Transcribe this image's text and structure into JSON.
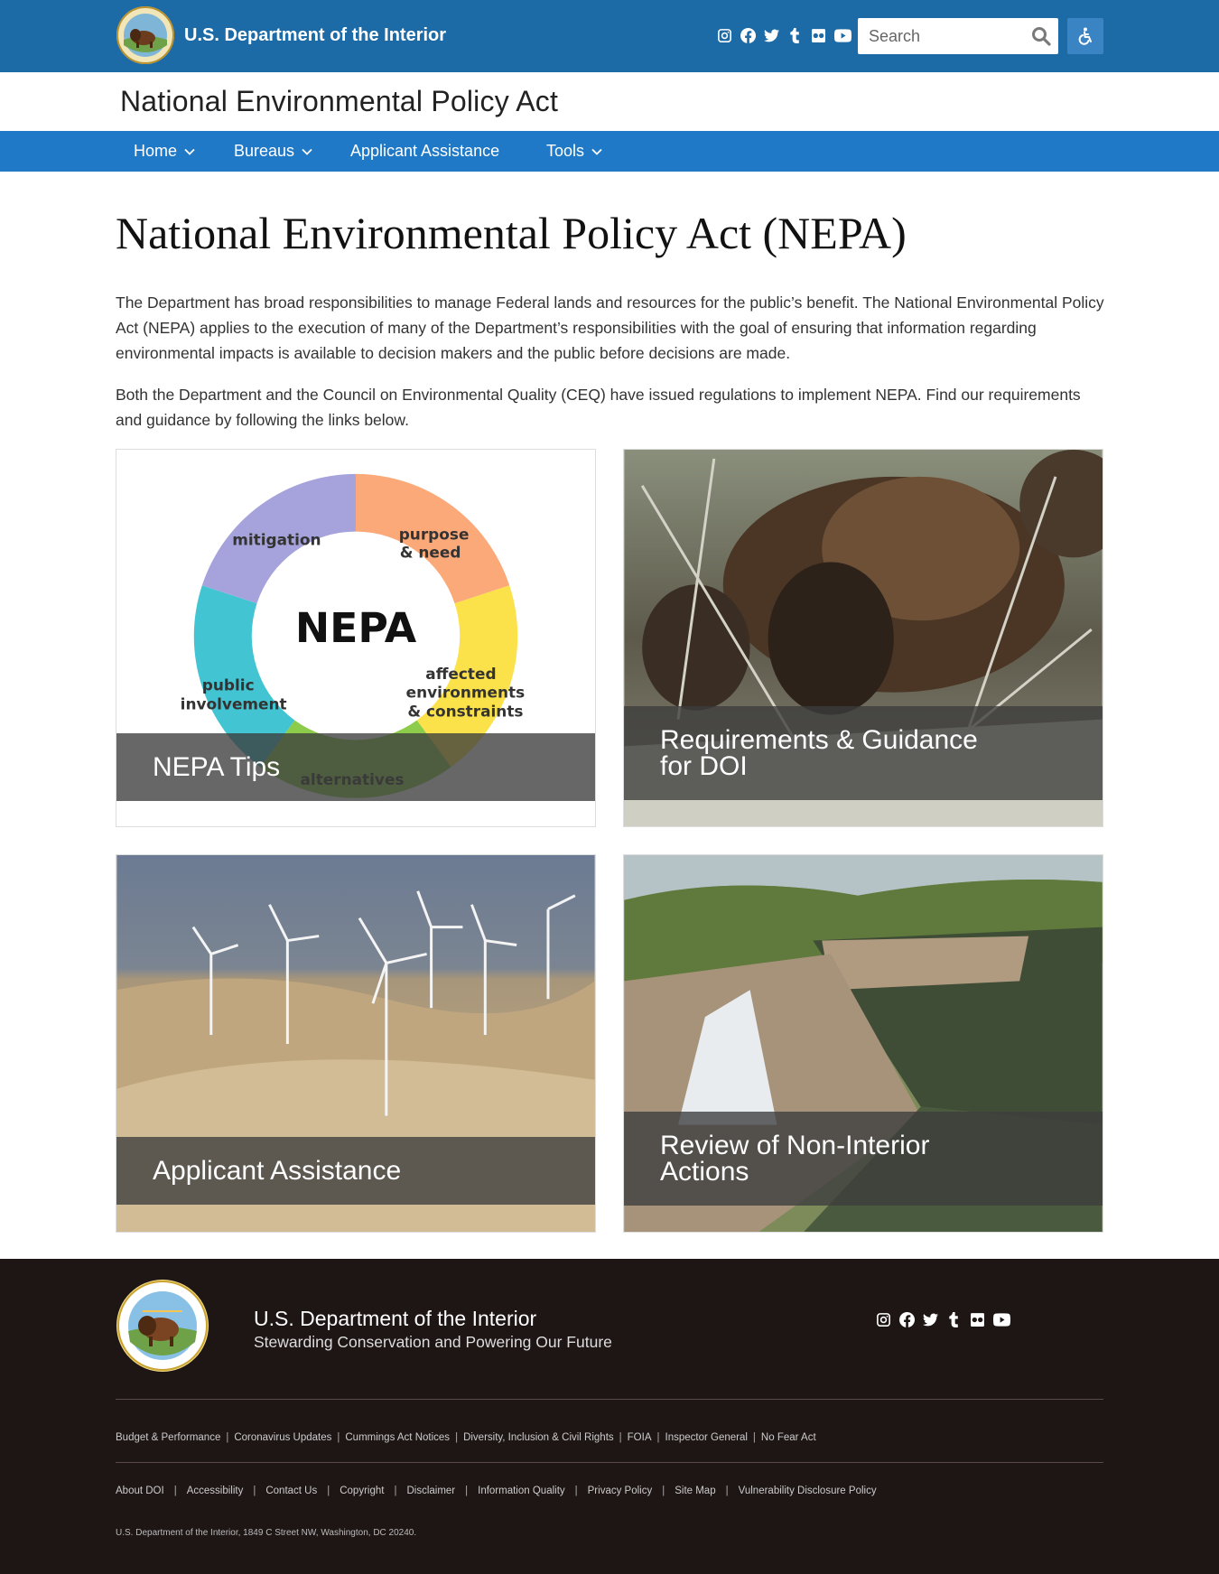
{
  "header": {
    "agency_name": "U.S. Department of the Interior",
    "social_icons": [
      "instagram-icon",
      "facebook-icon",
      "twitter-icon",
      "tumblr-icon",
      "flickr-icon",
      "youtube-icon"
    ],
    "search": {
      "placeholder": "Search"
    }
  },
  "site_title": "National Environmental Policy Act",
  "nav": [
    {
      "label": "Home",
      "dropdown": true
    },
    {
      "label": "Bureaus",
      "dropdown": true
    },
    {
      "label": "Applicant Assistance",
      "dropdown": false
    },
    {
      "label": "Tools",
      "dropdown": true
    }
  ],
  "main": {
    "title": "National Environmental Policy Act (NEPA)",
    "paragraph1": "The Department has broad responsibilities to manage Federal lands and resources for the public’s benefit. The National Environmental Policy Act (NEPA) applies to the execution of many of the Department’s responsibilities with the goal of ensuring that information regarding environmental impacts is available to decision makers and the public before decisions are made.",
    "paragraph2": "Both the Department and the Council on Environmental Quality (CEQ) have issued regulations to implement NEPA. Find our requirements and guidance by following the links below.",
    "cards": [
      {
        "label": "NEPA Tips"
      },
      {
        "label": "Requirements & Guidance for DOI"
      },
      {
        "label": "Applicant Assistance"
      },
      {
        "label": "Review of Non-Interior Actions"
      }
    ],
    "nepa_diagram": {
      "center": "NEPA",
      "segments": [
        "mitigation",
        "purpose & need",
        "affected environments & constraints",
        "alternatives",
        "public involvement"
      ]
    }
  },
  "footer": {
    "title": "U.S. Department of the Interior",
    "tagline": "Stewarding Conservation and Powering Our Future",
    "links_row1": [
      "Budget & Performance",
      "Coronavirus Updates",
      "Cummings Act Notices",
      "Diversity, Inclusion & Civil Rights",
      "FOIA",
      "Inspector General",
      "No Fear Act"
    ],
    "links_row2": [
      "About DOI",
      "Accessibility",
      "Contact Us",
      "Copyright",
      "Disclaimer",
      "Information Quality",
      "Privacy Policy",
      "Site Map",
      "Vulnerability Disclosure Policy"
    ],
    "address": "U.S. Department of the Interior, 1849 C Street NW, Washington, DC 20240."
  },
  "colors": {
    "header_blue": "#1c6aa6",
    "nav_blue": "#2079c7",
    "footer_bg": "#1e1515"
  }
}
